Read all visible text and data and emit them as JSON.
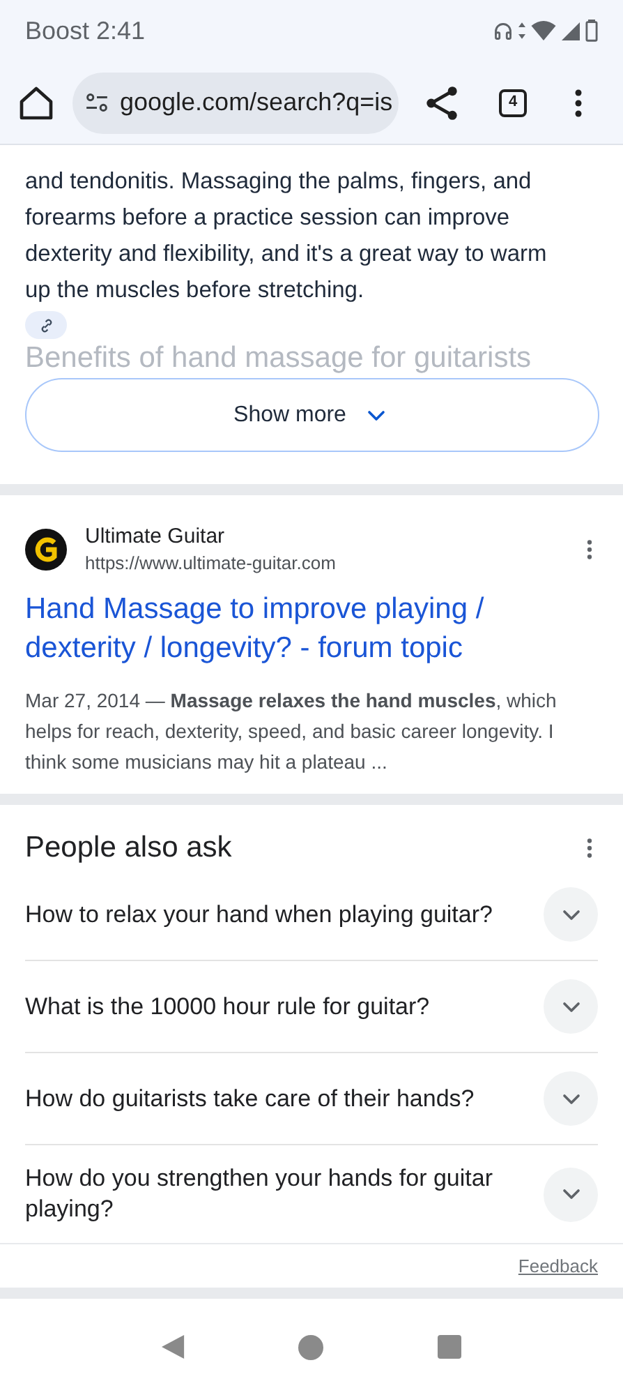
{
  "status_bar": {
    "carrier_time": "Boost 2:41"
  },
  "toolbar": {
    "url": "google.com/search?q=is",
    "tab_count": "4"
  },
  "featured_snippet": {
    "text": "and tendonitis. Massaging the palms, fingers, and forearms before a practice session can improve dexterity and flexibility, and it's a great way to warm up the muscles before stretching.",
    "faded_heading": "Benefits of hand massage for guitarists",
    "show_more": "Show more"
  },
  "result": {
    "site_name": "Ultimate Guitar",
    "url": "https://www.ultimate-guitar.com",
    "title": "Hand Massage to improve playing / dexterity / longevity? - forum topic",
    "snippet": "Mar 27, 2014 — **Massage relaxes the hand muscles**, which helps for reach, dexterity, speed, and basic career longevity. I think some musicians may hit a plateau ..."
  },
  "people_also_ask": {
    "title": "People also ask",
    "questions": [
      {
        "text": "How to relax your hand when playing guitar?",
        "expanded": false
      },
      {
        "text": "What is the 10000 hour rule for guitar?",
        "expanded": false
      },
      {
        "text": "How do guitarists take care of their hands?",
        "expanded": false
      },
      {
        "text": "How do you strengthen your hands for guitar playing?",
        "expanded": false
      }
    ],
    "feedback": "Feedback"
  }
}
